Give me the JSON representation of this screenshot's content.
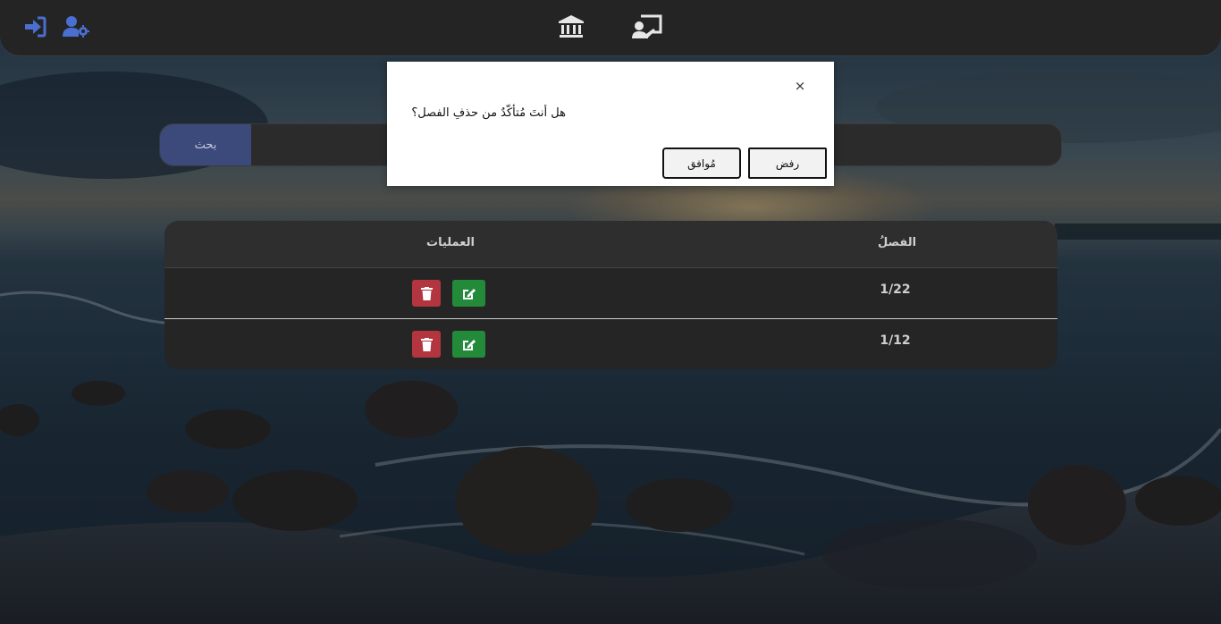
{
  "colors": {
    "nav_icon_blue": "#4a6fd1",
    "nav_icon_white": "#e6e6e6",
    "search_button": "#3b4a7a",
    "delete_button": "#b3353f",
    "edit_button": "#238a3a",
    "navbar": "#242424",
    "table": "#252525"
  },
  "navbar": {
    "icons": [
      "logout-icon",
      "user-settings-icon",
      "institution-icon",
      "classroom-teacher-icon"
    ]
  },
  "search": {
    "button_label": "بحث",
    "placeholder": "",
    "value": ""
  },
  "table": {
    "headers": {
      "class": "الفصلُ",
      "actions": "العمليات"
    },
    "rows": [
      {
        "class": "1/22",
        "actions": [
          "edit-icon",
          "trash-icon"
        ]
      },
      {
        "class": "1/12",
        "actions": [
          "edit-icon",
          "trash-icon"
        ]
      }
    ]
  },
  "modal": {
    "close_symbol": "×",
    "message": "هل أنتَ مُتأكّدٌ من حذفِ الفصل؟",
    "ok_label": "مُوافق",
    "cancel_label": "رفض"
  }
}
